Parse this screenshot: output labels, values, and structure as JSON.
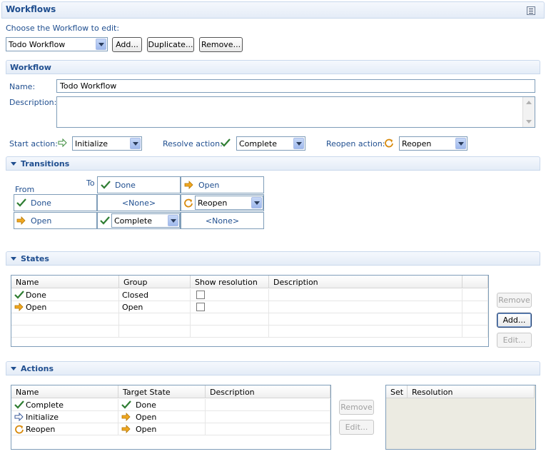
{
  "header": {
    "title": "Workflows",
    "menu_icon": "view-menu-icon"
  },
  "chooser": {
    "label": "Choose the Workflow to edit:",
    "selected": "Todo Workflow",
    "add": "Add...",
    "duplicate": "Duplicate...",
    "remove": "Remove..."
  },
  "workflow": {
    "section_title": "Workflow",
    "name_label": "Name:",
    "name_value": "Todo Workflow",
    "description_label": "Description:",
    "description_value": "",
    "start_label": "Start action:",
    "start_value": "Initialize",
    "resolve_label": "Resolve action:",
    "resolve_value": "Complete",
    "reopen_label": "Reopen action:",
    "reopen_value": "Reopen"
  },
  "transitions": {
    "section_title": "Transitions",
    "to_label": "To",
    "from_label": "From",
    "columns": [
      "Done",
      "Open"
    ],
    "rows": [
      {
        "from": "Done",
        "cells": [
          "<None>",
          "Reopen"
        ]
      },
      {
        "from": "Open",
        "cells": [
          "Complete",
          "<None>"
        ]
      }
    ]
  },
  "states": {
    "section_title": "States",
    "headers": [
      "Name",
      "Group",
      "Show resolution",
      "Description"
    ],
    "rows": [
      {
        "name": "Done",
        "group": "Closed",
        "description": ""
      },
      {
        "name": "Open",
        "group": "Open",
        "description": ""
      }
    ],
    "remove": "Remove",
    "add": "Add...",
    "edit": "Edit..."
  },
  "actions": {
    "section_title": "Actions",
    "headers": [
      "Name",
      "Target State",
      "Description"
    ],
    "rows": [
      {
        "name": "Complete",
        "target": "Done",
        "description": ""
      },
      {
        "name": "Initialize",
        "target": "Open",
        "description": ""
      },
      {
        "name": "Reopen",
        "target": "Open",
        "description": ""
      }
    ],
    "remove": "Remove",
    "edit": "Edit...",
    "resolution_headers": [
      "Set",
      "Resolution"
    ]
  },
  "colors": {
    "accent": "#1f4e8f",
    "check": "#2e7d32",
    "arrow": "#e8a317"
  }
}
